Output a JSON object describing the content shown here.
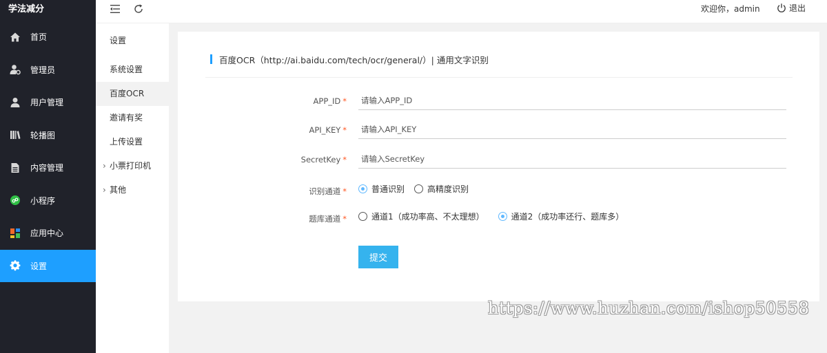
{
  "brand": "学法减分",
  "sidebar": {
    "items": [
      {
        "label": "首页",
        "icon": "home-icon"
      },
      {
        "label": "管理员",
        "icon": "admin-user-icon"
      },
      {
        "label": "用户管理",
        "icon": "user-icon"
      },
      {
        "label": "轮播图",
        "icon": "carousel-icon"
      },
      {
        "label": "内容管理",
        "icon": "document-icon"
      },
      {
        "label": "小程序",
        "icon": "mini-program-icon"
      },
      {
        "label": "应用中心",
        "icon": "apps-icon"
      },
      {
        "label": "设置",
        "icon": "gear-icon",
        "active": true
      }
    ]
  },
  "header": {
    "welcome": "欢迎你，admin",
    "logout": "退出"
  },
  "submenu": {
    "title": "设置",
    "items": [
      {
        "label": "系统设置"
      },
      {
        "label": "百度OCR",
        "active": true
      },
      {
        "label": "邀请有奖"
      },
      {
        "label": "上传设置"
      },
      {
        "label": "小票打印机",
        "expandable": true
      },
      {
        "label": "其他",
        "expandable": true
      }
    ]
  },
  "card": {
    "title": "百度OCR（http://ai.baidu.com/tech/ocr/general/）| 通用文字识别",
    "required_mark": "*",
    "fields": [
      {
        "label": "APP_ID",
        "placeholder": "请输入APP_ID",
        "value": ""
      },
      {
        "label": "API_KEY",
        "placeholder": "请输入API_KEY",
        "value": ""
      },
      {
        "label": "SecretKey",
        "placeholder": "请输入SecretKey",
        "value": ""
      }
    ],
    "recognition": {
      "label": "识别通道",
      "options": [
        "普通识别",
        "高精度识别"
      ],
      "selected": "普通识别"
    },
    "question_bank": {
      "label": "题库通道",
      "options": [
        "通道1（成功率高、不太理想）",
        "通道2（成功率还行、题库多）"
      ],
      "selected": "通道2（成功率还行、题库多）"
    },
    "submit": "提交"
  },
  "watermark": "https://www.huzhan.com/ishop50558",
  "colors": {
    "sidebar_bg": "#20222a",
    "accent": "#1e9fff",
    "button": "#35b3ee",
    "radio_checked": "#5fb8ff",
    "required": "#ff5722"
  }
}
